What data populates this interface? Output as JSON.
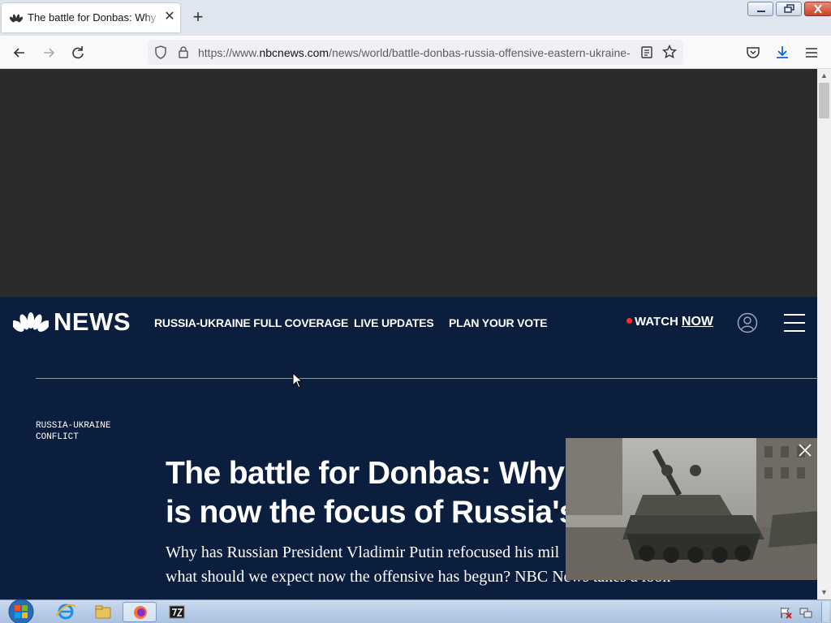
{
  "browser": {
    "tab_title": "The battle for Donbas: Why Putin",
    "tab_close": "✕",
    "new_tab": "+",
    "url_prefix": "https://www.",
    "url_host": "nbcnews.com",
    "url_path": "/news/world/battle-donbas-russia-offensive-eastern-ukraine-"
  },
  "site": {
    "logo_text": "NEWS",
    "nav": [
      {
        "label": "RUSSIA-UKRAINE FULL COVERAGE"
      },
      {
        "label": "LIVE UPDATES"
      },
      {
        "label": "PLAN YOUR VOTE"
      }
    ],
    "watch_label": "WATCH",
    "watch_now": "NOW"
  },
  "article": {
    "kicker": "RUSSIA-UKRAINE CONFLICT",
    "headline_line1": "The battle for Donbas: Why ea",
    "headline_line2": "is now the focus of Russia's w",
    "dek_line1": "Why has Russian President Vladimir Putin refocused his mil",
    "dek_line2": "what should we expect now the offensive has begun? NBC News takes a look"
  },
  "colors": {
    "page_background": "#0b1e3e",
    "ad_background": "#2b2b2b",
    "live_dot": "#ff2d2d"
  }
}
